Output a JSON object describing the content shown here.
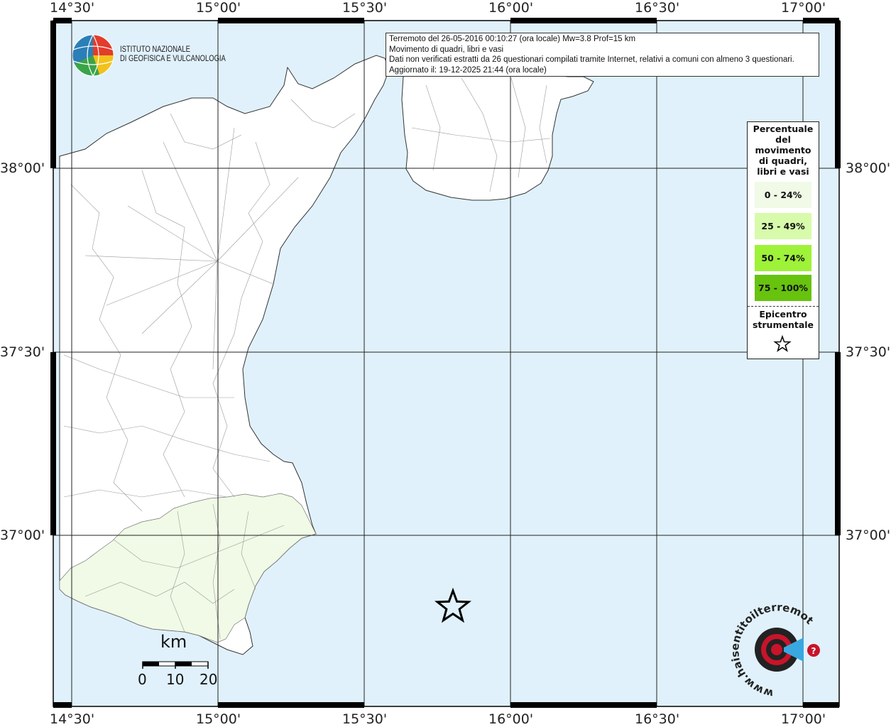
{
  "header": {
    "line1": "Terremoto del 26-05-2016 00:10:27 (ora locale) Mw=3.8 Prof=15 km",
    "line2": "Movimento di quadri, libri e vasi",
    "line3": "Dati non verificati estratti da 26 questionari compilati tramite Internet, relativi a comuni con almeno 3 questionari.",
    "line4": "Aggiornato il: 19-12-2025 21:44 (ora locale)"
  },
  "logo": {
    "line1": "ISTITUTO NAZIONALE",
    "line2": "DI GEOFISICA E VULCANOLOGIA"
  },
  "axes": {
    "longitudes": [
      "14°30'",
      "15°00'",
      "15°30'",
      "16°00'",
      "16°30'",
      "17°00'"
    ],
    "latitudes": [
      "38°00'",
      "37°30'",
      "37°00'"
    ]
  },
  "legend": {
    "title": "Percentuale del movimento di quadri, libri e vasi",
    "classes": [
      {
        "label": "0 - 24%",
        "color": "#f0fae6"
      },
      {
        "label": "25 - 49%",
        "color": "#d7fbab"
      },
      {
        "label": "50 - 74%",
        "color": "#9ef238"
      },
      {
        "label": "75 - 100%",
        "color": "#67c30e"
      }
    ],
    "epicenter_label": "Epicentro strumentale",
    "epicenter_icon": "star-outline-icon"
  },
  "scale": {
    "unit": "km",
    "ticks": [
      "0",
      "10",
      "20"
    ]
  },
  "watermark": {
    "text": "www.haisentitoilterremoto.it"
  },
  "colors": {
    "sea": "#e0f1fb",
    "land": "#ffffff",
    "felt_area": "#f0fae6",
    "borders": "#888888"
  }
}
